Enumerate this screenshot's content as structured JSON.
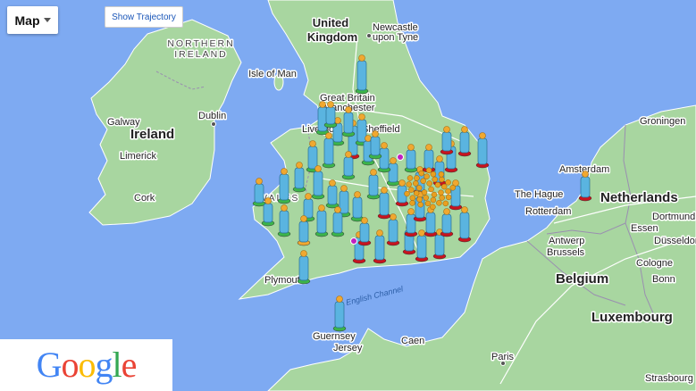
{
  "controls": {
    "map_type_label": "Map",
    "trajectory_label": "Show Trajectory"
  },
  "logo": {
    "letters": [
      {
        "ch": "G",
        "color": "#4285F4"
      },
      {
        "ch": "o",
        "color": "#EA4335"
      },
      {
        "ch": "o",
        "color": "#FBBC05"
      },
      {
        "ch": "g",
        "color": "#4285F4"
      },
      {
        "ch": "l",
        "color": "#34A853"
      },
      {
        "ch": "e",
        "color": "#EA4335"
      }
    ]
  },
  "colors": {
    "sea": "#7eaaf2",
    "land": "#a8d6a0",
    "person_body": "#5ab4e0",
    "person_head": "#f0a830",
    "base_green": "#3cb44a",
    "base_red": "#c8141e",
    "base_orange": "#f0a830",
    "cluster": "#e8a020"
  },
  "labels": [
    {
      "text": "United",
      "cls": "lbl-big"
    },
    {
      "text": "Kingdom",
      "cls": "lbl-big"
    },
    {
      "text": "Newcastle",
      "cls": "lbl-city"
    },
    {
      "text": "upon Tyne",
      "cls": "lbl-city"
    },
    {
      "text": "NORTHERN",
      "cls": "lbl-region"
    },
    {
      "text": "IRELAND",
      "cls": "lbl-region"
    },
    {
      "text": "Isle of Man",
      "cls": "lbl-city"
    },
    {
      "text": "Great Britain",
      "cls": "lbl-city"
    },
    {
      "text": "Manchester",
      "cls": "lbl-city"
    },
    {
      "text": "Liverpool",
      "cls": "lbl-city"
    },
    {
      "text": "Sheffield",
      "cls": "lbl-city"
    },
    {
      "text": "Galway",
      "cls": "lbl-city"
    },
    {
      "text": "Dublin",
      "cls": "lbl-city"
    },
    {
      "text": "Ireland",
      "cls": "lbl-country"
    },
    {
      "text": "Limerick",
      "cls": "lbl-city"
    },
    {
      "text": "Cork",
      "cls": "lbl-city"
    },
    {
      "text": "Groningen",
      "cls": "lbl-city"
    },
    {
      "text": "Amsterdam",
      "cls": "lbl-city"
    },
    {
      "text": "The Hague",
      "cls": "lbl-city"
    },
    {
      "text": "Netherlands",
      "cls": "lbl-country"
    },
    {
      "text": "Rotterdam",
      "cls": "lbl-city"
    },
    {
      "text": "Dortmund",
      "cls": "lbl-city"
    },
    {
      "text": "Essen",
      "cls": "lbl-city"
    },
    {
      "text": "Antwerp",
      "cls": "lbl-city"
    },
    {
      "text": "Düsseldorf",
      "cls": "lbl-city"
    },
    {
      "text": "Brussels",
      "cls": "lbl-city"
    },
    {
      "text": "Cologne",
      "cls": "lbl-city"
    },
    {
      "text": "Belgium",
      "cls": "lbl-country"
    },
    {
      "text": "Bonn",
      "cls": "lbl-city"
    },
    {
      "text": "Luxembourg",
      "cls": "lbl-country"
    },
    {
      "text": "Plymouth",
      "cls": "lbl-city"
    },
    {
      "text": "English Channel",
      "cls": "lbl-sea"
    },
    {
      "text": "Guernsey",
      "cls": "lbl-city"
    },
    {
      "text": "Jersey",
      "cls": "lbl-city"
    },
    {
      "text": "Caen",
      "cls": "lbl-city"
    },
    {
      "text": "Paris",
      "cls": "lbl-city"
    },
    {
      "text": "Strasbourg",
      "cls": "lbl-city"
    },
    {
      "text": "WALES",
      "cls": "lbl-region"
    }
  ]
}
